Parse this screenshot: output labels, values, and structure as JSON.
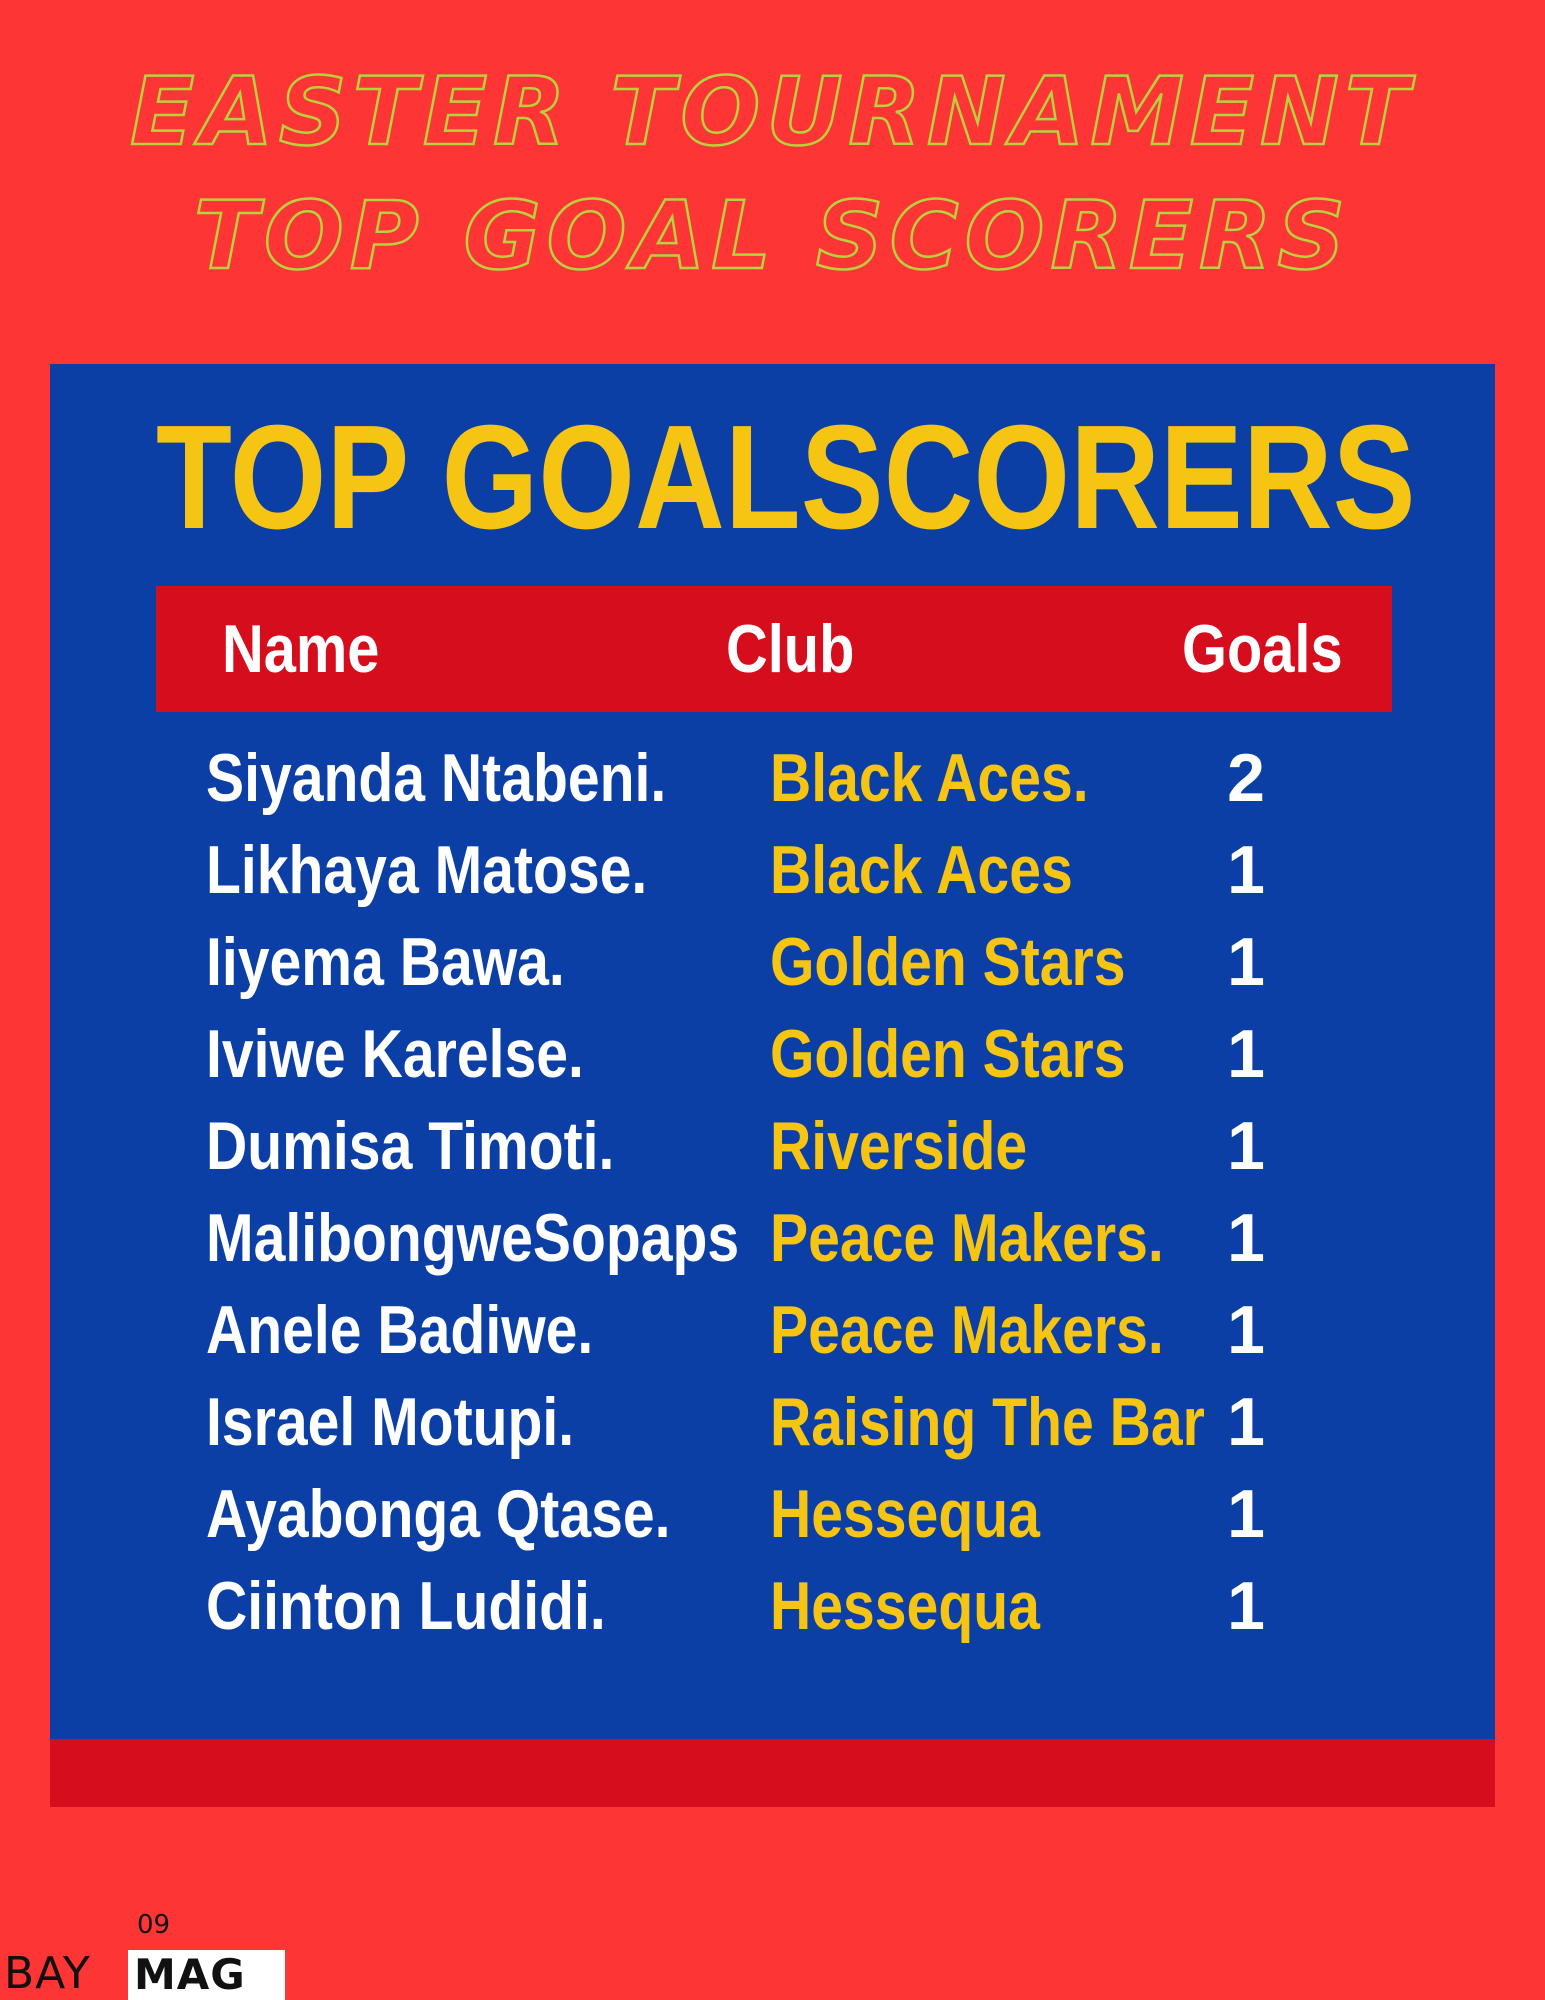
{
  "headline": {
    "line1": "EASTER TOURNAMENT",
    "line2": "TOP GOAL SCORERS"
  },
  "panel": {
    "title": "TOP GOALSCORERS",
    "columns": {
      "name": "Name",
      "club": "Club",
      "goals": "Goals"
    },
    "rows": [
      {
        "name": "Siyanda Ntabeni.",
        "club": "Black Aces.",
        "goals": "2"
      },
      {
        "name": "Likhaya Matose.",
        "club": "Black Aces",
        "goals": "1"
      },
      {
        "name": "Iiyema Bawa.",
        "club": "Golden Stars",
        "goals": "1"
      },
      {
        "name": "Iviwe Karelse.",
        "club": "Golden Stars",
        "goals": "1"
      },
      {
        "name": "Dumisa Timoti.",
        "club": "Riverside",
        "goals": "1"
      },
      {
        "name": "MalibongweSopaps",
        "club": "Peace Makers.",
        "goals": "1"
      },
      {
        "name": "Anele Badiwe.",
        "club": "Peace Makers.",
        "goals": "1"
      },
      {
        "name": "Israel Motupi.",
        "club": "Raising The Bar",
        "goals": "1"
      },
      {
        "name": "Ayabonga Qtase.",
        "club": "Hessequa",
        "goals": "1"
      },
      {
        "name": "Ciinton Ludidi.",
        "club": "Hessequa",
        "goals": "1"
      }
    ]
  },
  "footer": {
    "page_number": "09",
    "brand_left": "BAY",
    "brand_right": "MAG"
  },
  "colors": {
    "page_background": "#fd3535",
    "headline_outline": "#b8d13c",
    "panel_blue": "#0c3fa6",
    "header_red": "#d60d1d",
    "title_yellow": "#f6c513",
    "club_yellow": "#f6c513",
    "name_white": "#ffffff"
  }
}
